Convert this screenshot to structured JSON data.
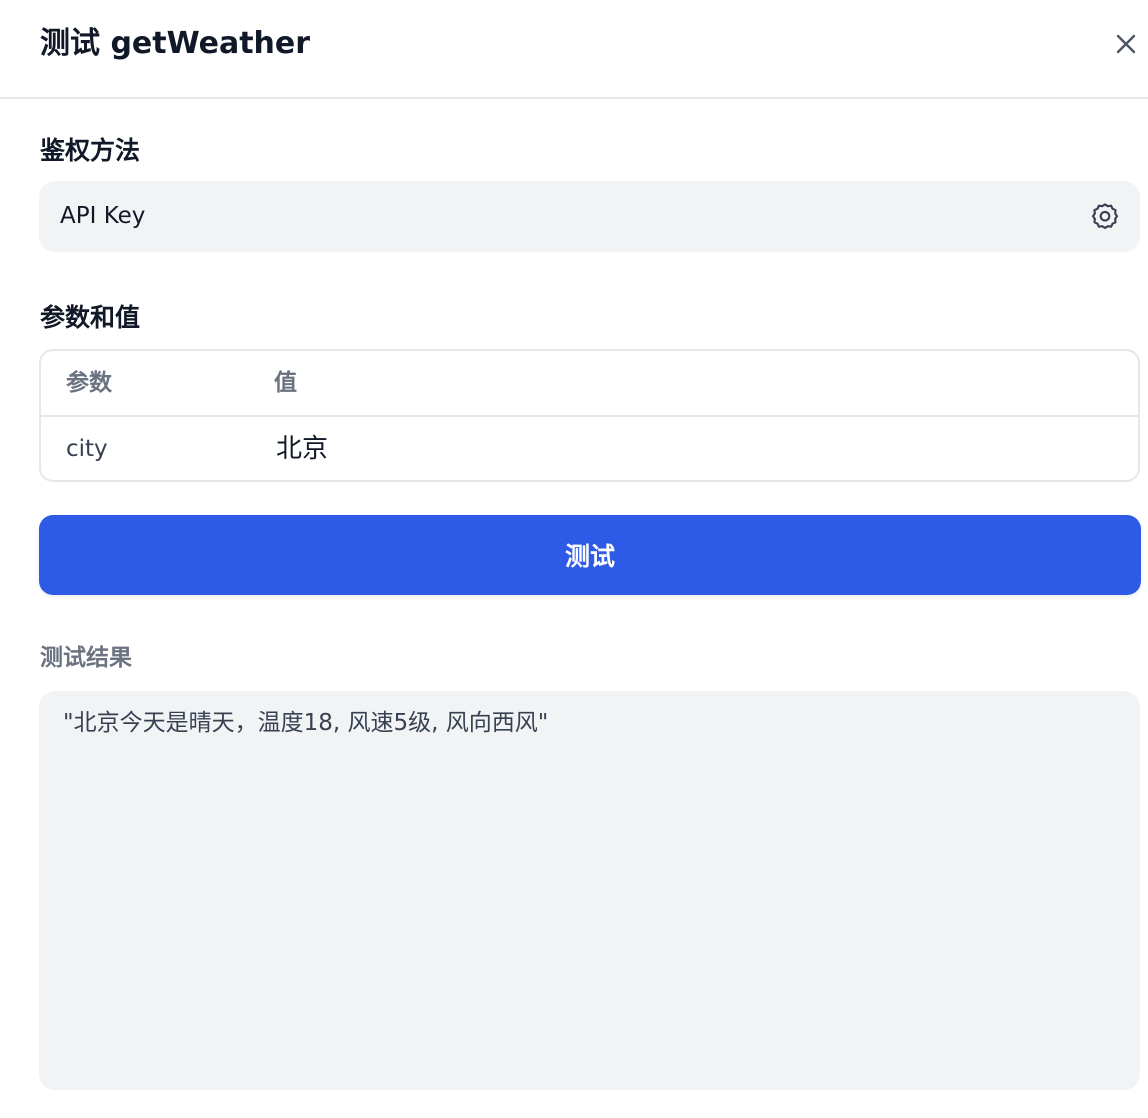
{
  "dialog": {
    "title": "测试 getWeather",
    "close_icon": "close-icon"
  },
  "auth": {
    "label": "鉴权方法",
    "value": "API Key",
    "settings_icon": "gear-icon"
  },
  "params": {
    "label": "参数和值",
    "columns": [
      "参数",
      "值"
    ],
    "rows": [
      {
        "key": "city",
        "value": "北京"
      }
    ]
  },
  "actions": {
    "test_label": "测试"
  },
  "result": {
    "label": "测试结果",
    "text": "\"北京今天是晴天，温度18, 风速5级, 风向西风\""
  },
  "colors": {
    "primary": "#2e5be6",
    "field_bg": "#f2f3f5",
    "border": "#e5e7eb",
    "muted_text": "#6b7280"
  }
}
